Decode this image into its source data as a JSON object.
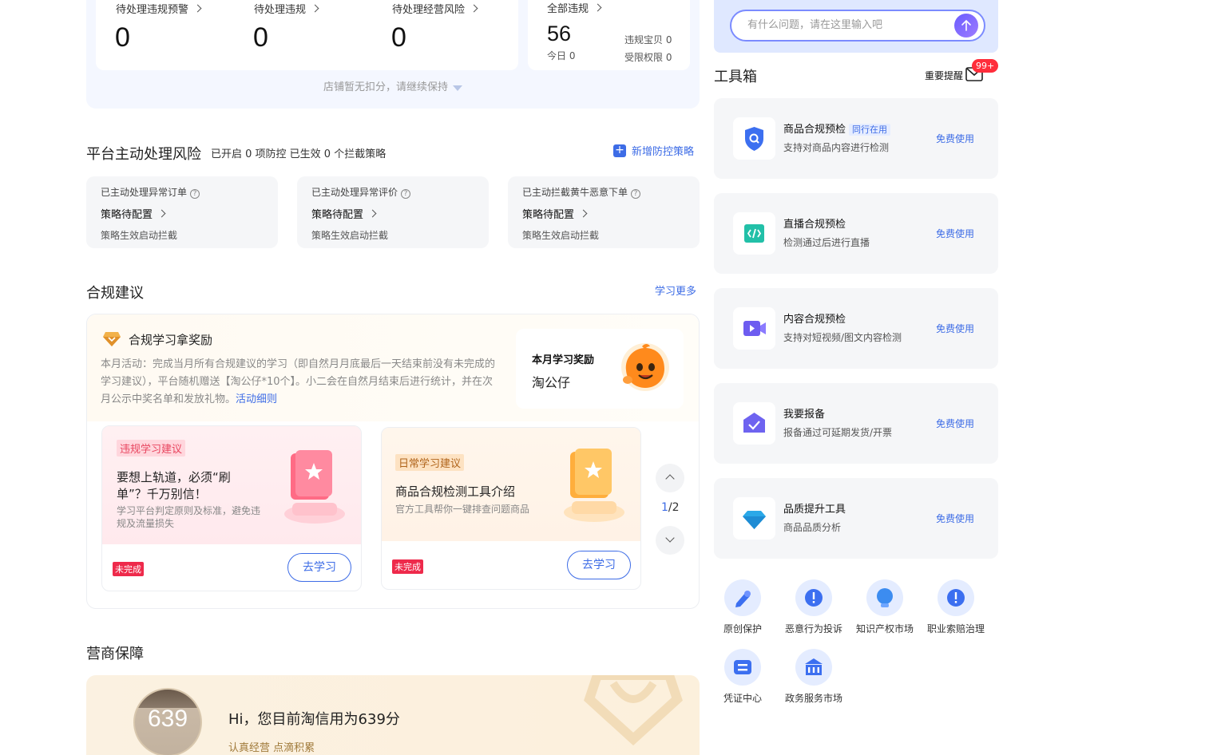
{
  "stats": {
    "items": [
      {
        "label": "待处理违规预警",
        "value": "0"
      },
      {
        "label": "待处理违规",
        "value": "0"
      },
      {
        "label": "待处理经营风险",
        "value": "0"
      }
    ],
    "all": {
      "label": "全部违规",
      "value": "56",
      "today": "今日 0",
      "shop_items": "违规宝贝 0",
      "restricted": "受限权限 0"
    },
    "footnote": "店铺暂无扣分，请继续保持"
  },
  "risk": {
    "title": "平台主动处理风险",
    "summary": "已开启 0 项防控 已生效 0 个拦截策略",
    "add_link": "新增防控策略",
    "cards": [
      {
        "title": "已主动处理异常订单",
        "status": "策略待配置",
        "desc": "策略生效启动拦截"
      },
      {
        "title": "已主动处理异常评价",
        "status": "策略待配置",
        "desc": "策略生效启动拦截"
      },
      {
        "title": "已主动拦截黄牛恶意下单",
        "status": "策略待配置",
        "desc": "策略生效启动拦截"
      }
    ]
  },
  "advice": {
    "title": "合规建议",
    "more": "学习更多",
    "reward_title": "合规学习拿奖励",
    "activity_text": "本月活动：完成当月所有合规建议的学习（即自然月月底最后一天结束前没有未完成的学习建议），平台随机赠送【淘公仔*10个】。小二会在自然月结束后进行统计，并在次月公示中奖名单和发放礼物。",
    "activity_link": "活动细则",
    "monthly_label": "本月学习奖励",
    "monthly_prize": "淘公仔",
    "cards": [
      {
        "tag": "违规学习建议",
        "title": "要想上轨道，必须“刷单”？千万别信！",
        "desc": "学习平台判定原则及标准，避免违规及流量损失",
        "status": "未完成",
        "button": "去学习"
      },
      {
        "tag": "日常学习建议",
        "title": "商品合规检测工具介绍",
        "desc": "官方工具帮你一键排查问题商品",
        "status": "未完成",
        "button": "去学习"
      }
    ],
    "page_current": "1",
    "page_total": "/2"
  },
  "guarantee": {
    "title": "营商保障",
    "score": "639",
    "greeting": "Hi，您目前淘信用为639分",
    "slogan": "认真经营 点滴积累"
  },
  "chat": {
    "placeholder": "有什么问题，请在这里输入吧"
  },
  "toolbox": {
    "title": "工具箱",
    "reminder": "重要提醒",
    "badge": "99+",
    "tools": [
      {
        "name": "商品合规预检",
        "tag": "同行在用",
        "desc": "支持对商品内容进行检测",
        "action": "免费使用",
        "icon": "shield-search-icon"
      },
      {
        "name": "直播合规预检",
        "desc": "检测通过后进行直播",
        "action": "免费使用",
        "icon": "code-icon"
      },
      {
        "name": "内容合规预检",
        "desc": "支持对短视频/图文内容检测",
        "action": "免费使用",
        "icon": "video-icon"
      },
      {
        "name": "我要报备",
        "desc": "报备通过可延期发货/开票",
        "action": "免费使用",
        "icon": "check-house-icon"
      },
      {
        "name": "品质提升工具",
        "desc": "商品品质分析",
        "action": "免费使用",
        "icon": "diamond-icon"
      }
    ],
    "services": [
      {
        "label": "原创保护",
        "icon": "pen-icon"
      },
      {
        "label": "恶意行为投诉",
        "icon": "alert-icon"
      },
      {
        "label": "知识产权市场",
        "icon": "bulb-icon"
      },
      {
        "label": "职业索赔治理",
        "icon": "alert-icon"
      },
      {
        "label": "凭证中心",
        "icon": "voucher-icon"
      },
      {
        "label": "政务服务市场",
        "icon": "government-icon"
      }
    ]
  }
}
